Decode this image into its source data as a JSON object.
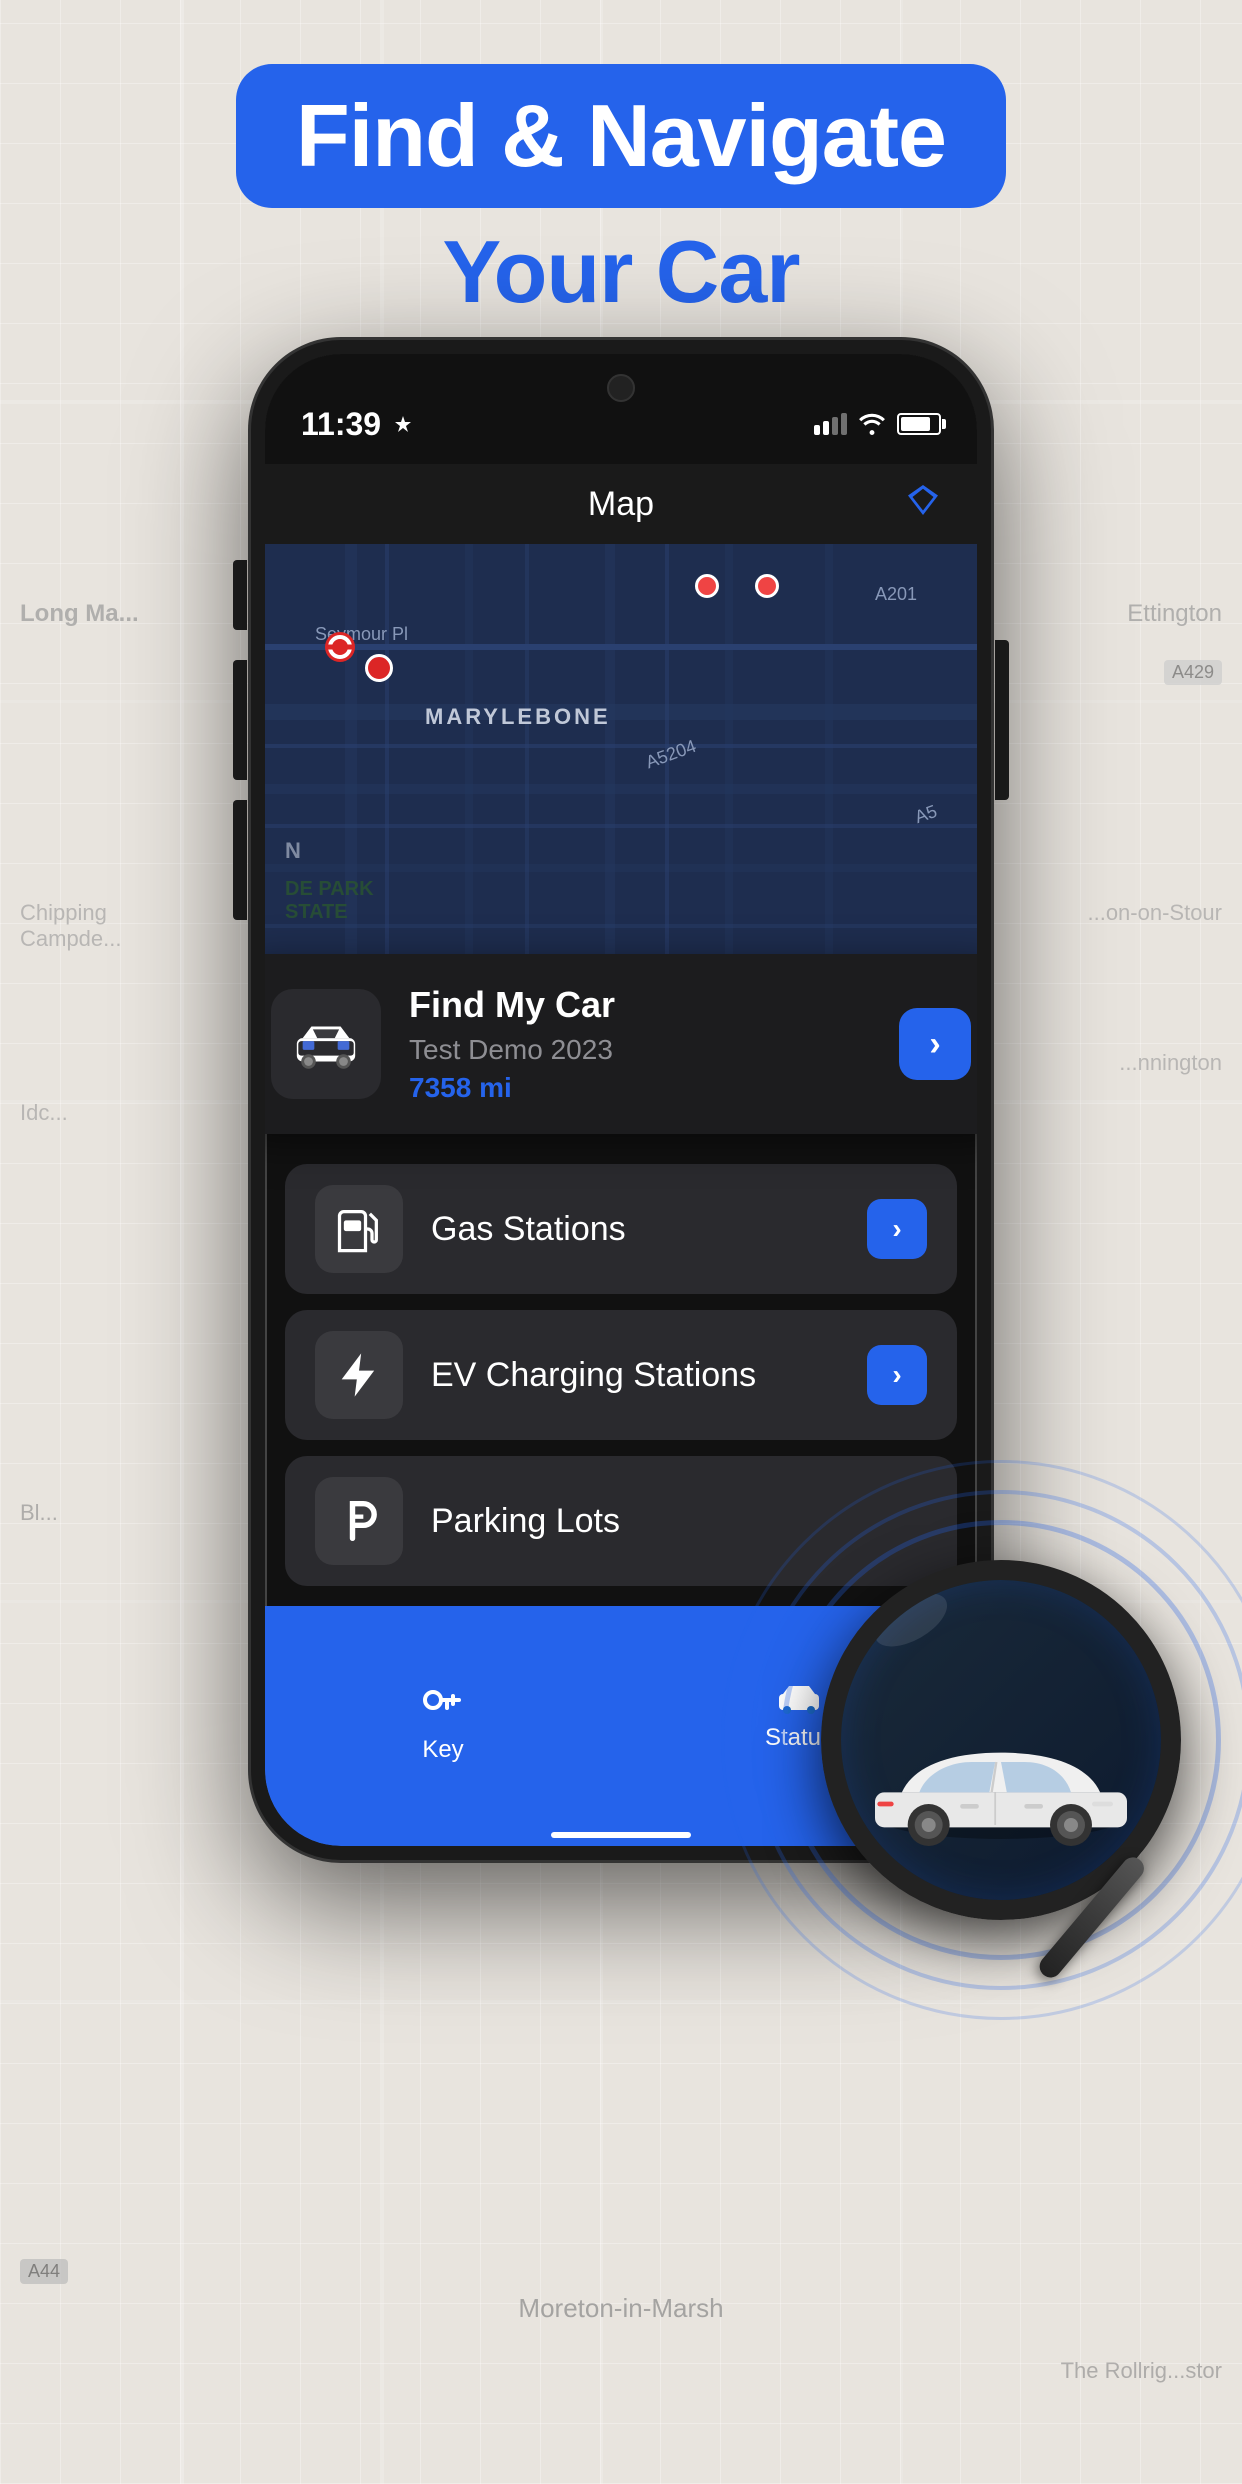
{
  "hero": {
    "badge_text": "Find & Navigate",
    "sub_text": "Your Car",
    "badge_bg": "#2563eb"
  },
  "status_bar": {
    "time": "11:39",
    "signal": "●●●",
    "wifi": "wifi",
    "battery": "80"
  },
  "app_header": {
    "title": "Map",
    "gem_icon": "◆"
  },
  "map": {
    "district": "MARYLEBONE"
  },
  "find_car_card": {
    "title": "Find My Car",
    "subtitle": "Test Demo 2023",
    "distance": "7358 mi",
    "arrow": "›"
  },
  "menu_items": [
    {
      "id": "gas-stations",
      "label": "Gas Stations",
      "icon": "⛽",
      "arrow": "›"
    },
    {
      "id": "ev-charging",
      "label": "EV Charging Stations",
      "icon": "⚡",
      "arrow": "›"
    },
    {
      "id": "parking",
      "label": "Parking Lots",
      "icon": "P",
      "arrow": "›"
    }
  ],
  "tab_bar": {
    "items": [
      {
        "id": "key",
        "label": "Key",
        "icon": "🔑"
      },
      {
        "id": "status",
        "label": "Status",
        "icon": "🚗"
      }
    ]
  },
  "colors": {
    "accent": "#2563eb",
    "bg_dark": "#1c1c1e",
    "card_bg": "#2a2a2e",
    "map_bg": "#1a2744"
  }
}
